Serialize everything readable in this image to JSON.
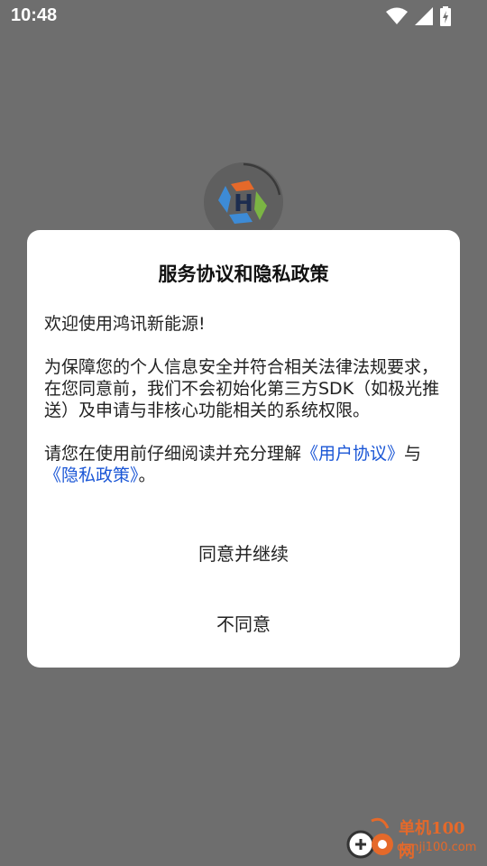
{
  "status_bar": {
    "time": "10:48",
    "icons": [
      "wifi-icon",
      "signal-icon",
      "battery-charging-icon"
    ]
  },
  "dialog": {
    "title": "服务协议和隐私政策",
    "welcome": "欢迎使用鸿讯新能源!",
    "para1": "为保障您的个人信息安全并符合相关法律法规要求，在您同意前，我们不会初始化第三方SDK（如极光推送）及申请与非核心功能相关的系统权限。",
    "para2_prefix": "请您在使用前仔细阅读并充分理解",
    "user_agreement_link": "《用户协议》",
    "conj": "与",
    "privacy_policy_link": "《隐私政策》",
    "period": "。",
    "agree_button": "同意并继续",
    "disagree_button": "不同意"
  },
  "logo": {
    "letter": "H",
    "colors": [
      "#e5692a",
      "#3d8bd6",
      "#7bb543",
      "#2b3e66"
    ]
  },
  "watermark": {
    "line1": "单机100网",
    "line2": "danji100.com"
  }
}
